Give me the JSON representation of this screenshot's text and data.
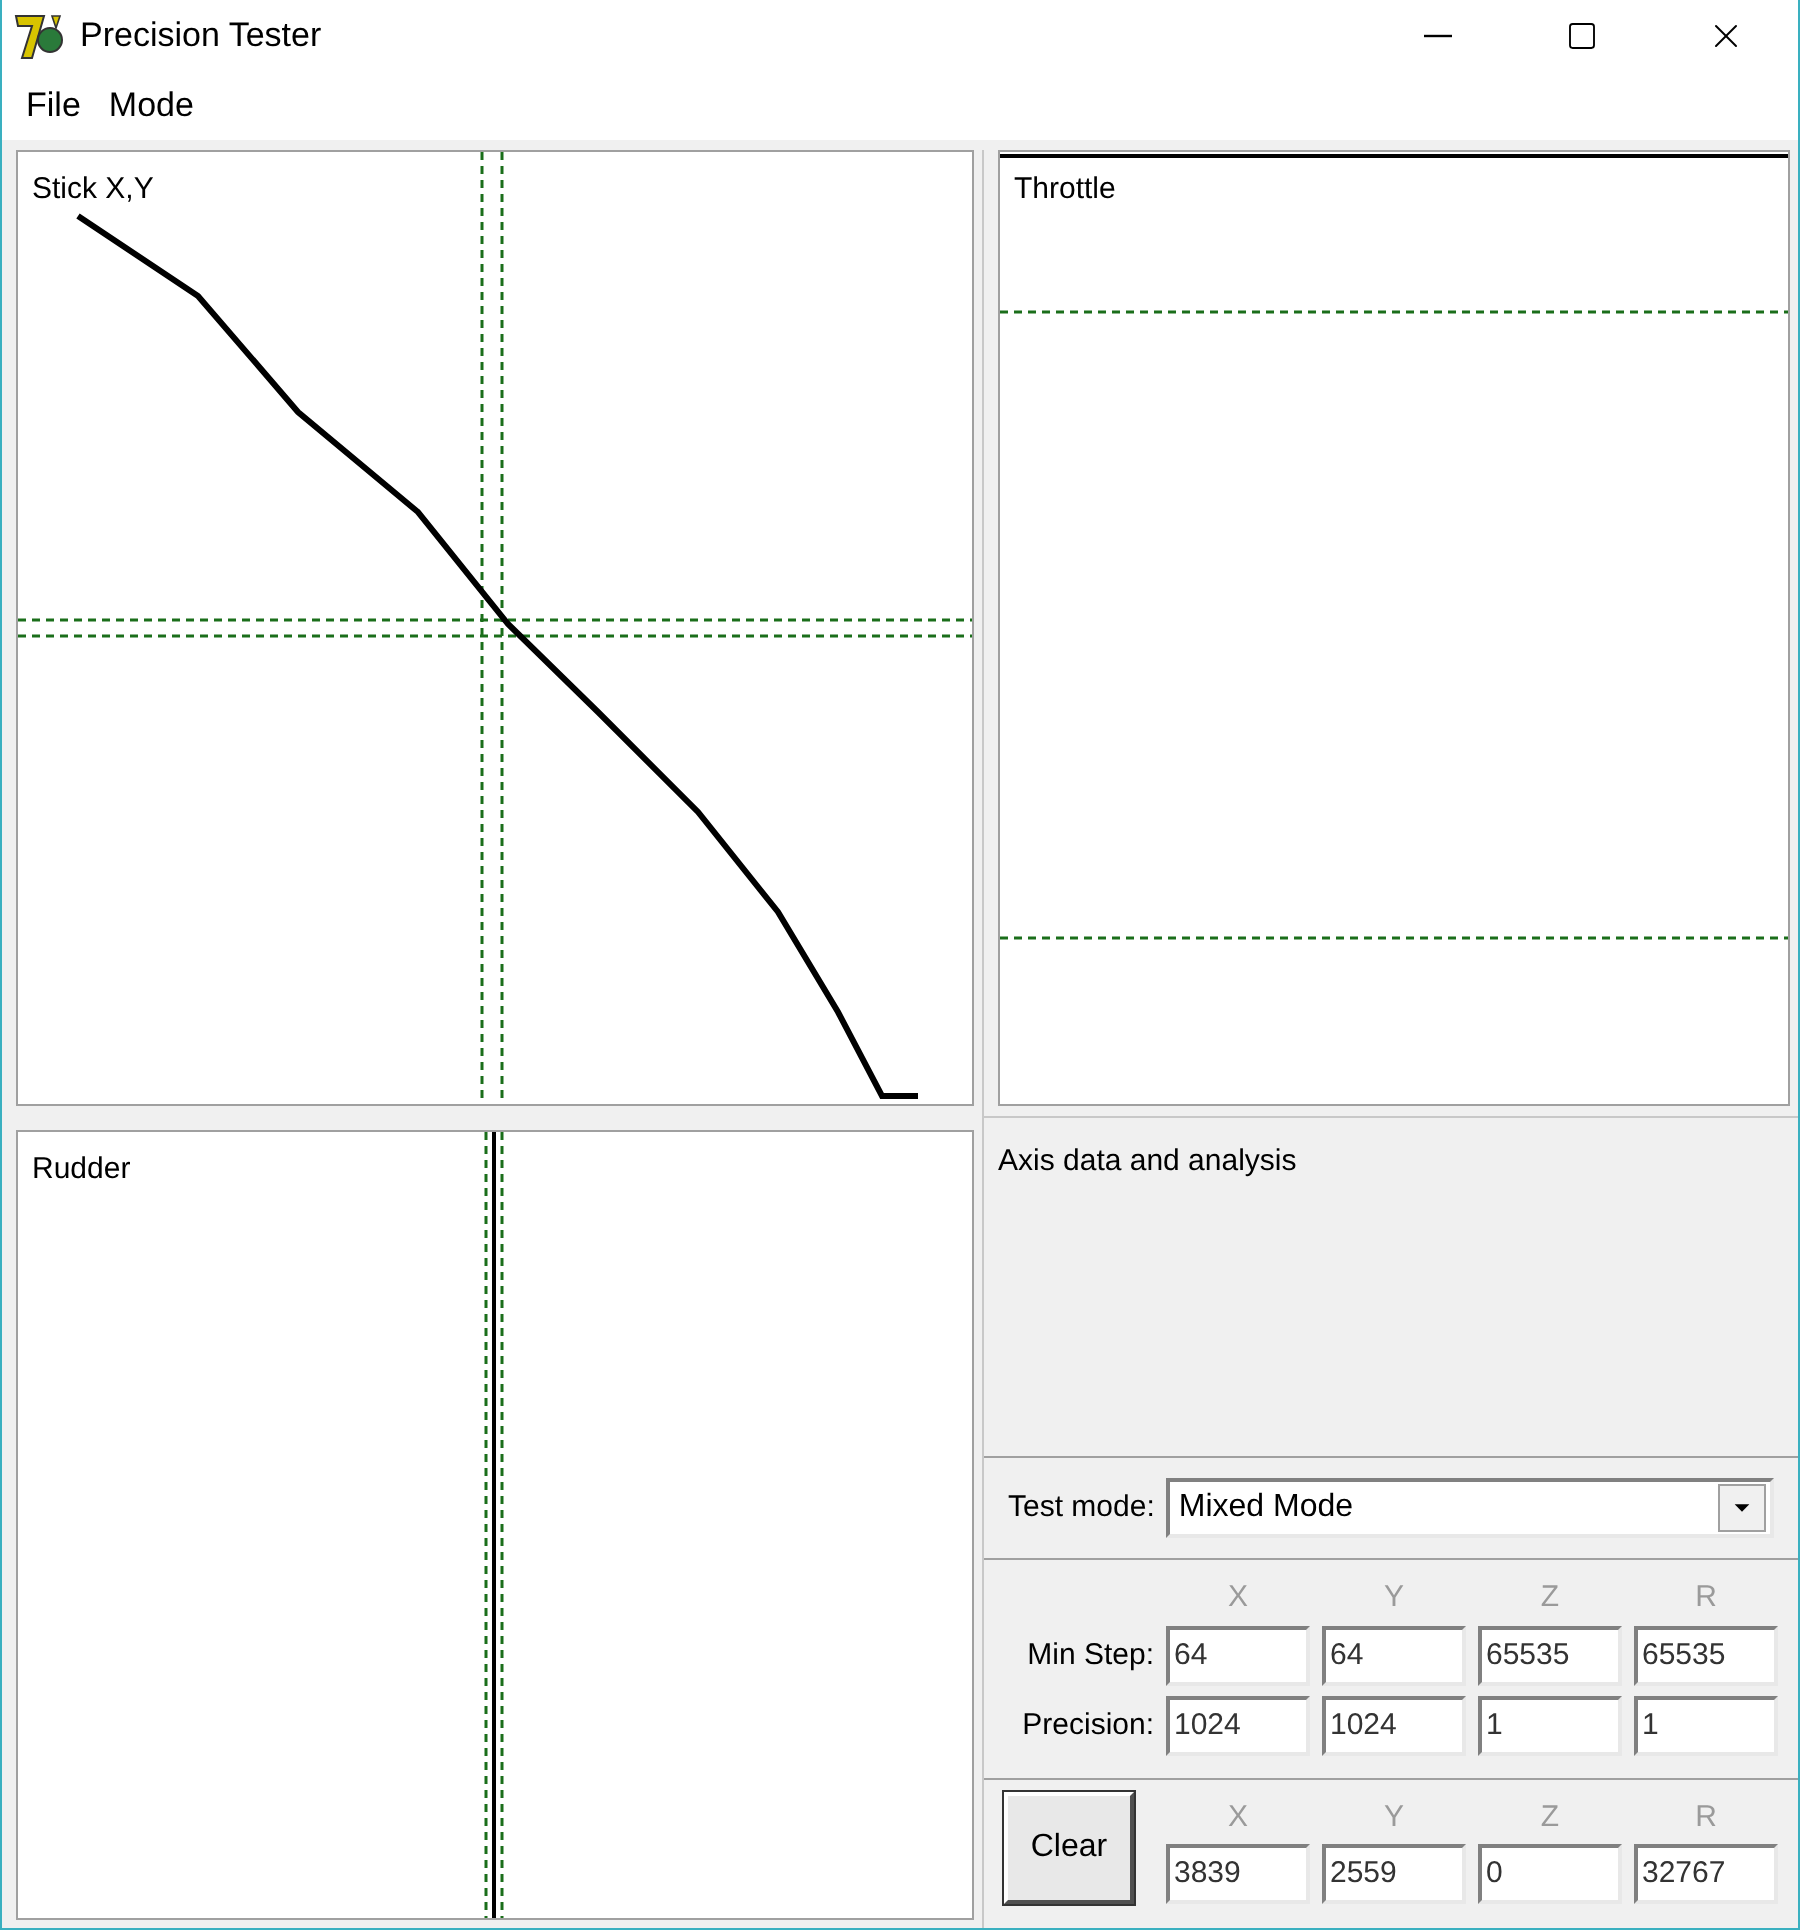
{
  "window": {
    "title": "Precision Tester"
  },
  "menu": [
    "File",
    "Mode"
  ],
  "plots": [
    {
      "title": "Stick X,Y",
      "kind": "xy"
    },
    {
      "title": "Throttle",
      "kind": "horizontal"
    },
    {
      "title": "Rudder",
      "kind": "vertical"
    }
  ],
  "analysis": {
    "title": "Axis data and analysis"
  },
  "test_mode": {
    "label": "Test mode:",
    "value": "Mixed Mode"
  },
  "stats": {
    "columns": [
      "X",
      "Y",
      "Z",
      "R"
    ],
    "rows": [
      {
        "label": "Min Step:",
        "values": [
          "64",
          "64",
          "65535",
          "65535"
        ]
      },
      {
        "label": "Precision:",
        "values": [
          "1024",
          "1024",
          "1",
          "1"
        ]
      }
    ]
  },
  "clear_button": "Clear",
  "current": {
    "columns": [
      "X",
      "Y",
      "Z",
      "R"
    ],
    "values": [
      "3839",
      "2559",
      "0",
      "32767"
    ]
  }
}
